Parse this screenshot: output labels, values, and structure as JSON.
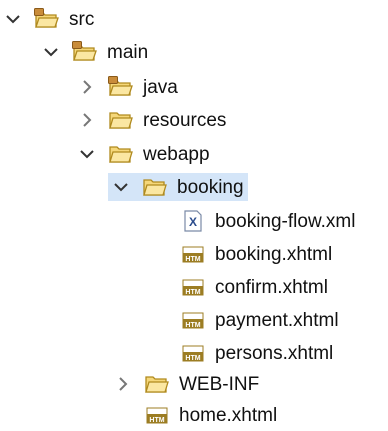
{
  "tree": {
    "src": {
      "label": "src",
      "expanded": true,
      "icon": "source-folder-icon"
    },
    "main": {
      "label": "main",
      "expanded": true,
      "icon": "source-folder-icon"
    },
    "java": {
      "label": "java",
      "expanded": false,
      "icon": "source-folder-icon"
    },
    "resources": {
      "label": "resources",
      "expanded": false,
      "icon": "folder-icon"
    },
    "webapp": {
      "label": "webapp",
      "expanded": true,
      "icon": "folder-icon"
    },
    "booking": {
      "label": "booking",
      "expanded": true,
      "selected": true,
      "icon": "folder-icon"
    },
    "booking_flow": {
      "label": "booking-flow.xml",
      "icon": "xml-file-icon",
      "badge": "X"
    },
    "booking_xhtml": {
      "label": "booking.xhtml",
      "icon": "html-file-icon",
      "badge": "HTM"
    },
    "confirm": {
      "label": "confirm.xhtml",
      "icon": "html-file-icon",
      "badge": "HTM"
    },
    "payment": {
      "label": "payment.xhtml",
      "icon": "html-file-icon",
      "badge": "HTM"
    },
    "persons": {
      "label": "persons.xhtml",
      "icon": "html-file-icon",
      "badge": "HTM"
    },
    "web_inf": {
      "label": "WEB-INF",
      "expanded": false,
      "icon": "folder-icon"
    },
    "home": {
      "label": "home.xhtml",
      "icon": "html-file-icon",
      "badge": "HTM"
    }
  },
  "colors": {
    "selection": "#d4e5f8",
    "folder_fill": "#f5d77a",
    "folder_stroke": "#b08a1e",
    "html_badge": "#9c7d23",
    "xml_badge": "#2b4c8c",
    "chevron": "#333333"
  }
}
